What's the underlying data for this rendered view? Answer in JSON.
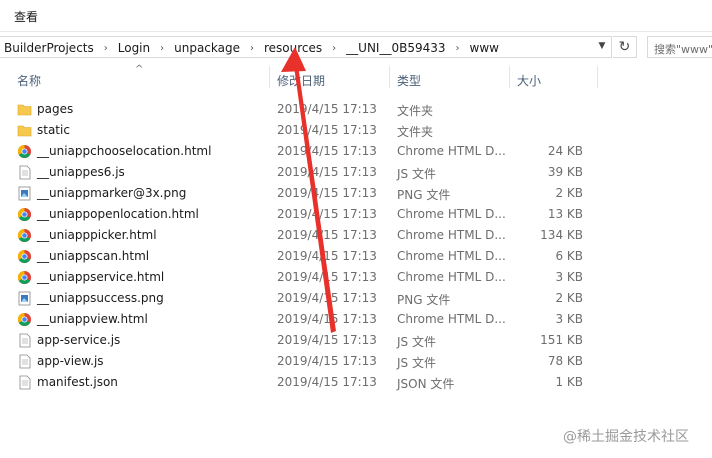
{
  "menubar": {
    "view_label": "查看"
  },
  "address": {
    "crumbs": [
      "BuilderProjects",
      "Login",
      "unpackage",
      "resources",
      "__UNI__0B59433",
      "www"
    ]
  },
  "search": {
    "placeholder": "搜索\"www\""
  },
  "columns": {
    "name": "名称",
    "date": "修改日期",
    "type": "类型",
    "size": "大小"
  },
  "files": [
    {
      "icon": "folder-icon",
      "name": "pages",
      "date": "2019/4/15 17:13",
      "type": "文件夹",
      "size": ""
    },
    {
      "icon": "folder-icon",
      "name": "static",
      "date": "2019/4/15 17:13",
      "type": "文件夹",
      "size": ""
    },
    {
      "icon": "chrome-html-icon",
      "name": "__uniappchooselocation.html",
      "date": "2019/4/15 17:13",
      "type": "Chrome HTML D...",
      "size": "24 KB"
    },
    {
      "icon": "js-file-icon",
      "name": "__uniappes6.js",
      "date": "2019/4/15 17:13",
      "type": "JS 文件",
      "size": "39 KB"
    },
    {
      "icon": "png-file-icon",
      "name": "__uniappmarker@3x.png",
      "date": "2019/4/15 17:13",
      "type": "PNG 文件",
      "size": "2 KB"
    },
    {
      "icon": "chrome-html-icon",
      "name": "__uniappopenlocation.html",
      "date": "2019/4/15 17:13",
      "type": "Chrome HTML D...",
      "size": "13 KB"
    },
    {
      "icon": "chrome-html-icon",
      "name": "__uniapppicker.html",
      "date": "2019/4/15 17:13",
      "type": "Chrome HTML D...",
      "size": "134 KB"
    },
    {
      "icon": "chrome-html-icon",
      "name": "__uniappscan.html",
      "date": "2019/4/15 17:13",
      "type": "Chrome HTML D...",
      "size": "6 KB"
    },
    {
      "icon": "chrome-html-icon",
      "name": "__uniappservice.html",
      "date": "2019/4/15 17:13",
      "type": "Chrome HTML D...",
      "size": "3 KB"
    },
    {
      "icon": "png-file-icon",
      "name": "__uniappsuccess.png",
      "date": "2019/4/15 17:13",
      "type": "PNG 文件",
      "size": "2 KB"
    },
    {
      "icon": "chrome-html-icon",
      "name": "__uniappview.html",
      "date": "2019/4/15 17:13",
      "type": "Chrome HTML D...",
      "size": "3 KB"
    },
    {
      "icon": "js-file-icon",
      "name": "app-service.js",
      "date": "2019/4/15 17:13",
      "type": "JS 文件",
      "size": "151 KB"
    },
    {
      "icon": "js-file-icon",
      "name": "app-view.js",
      "date": "2019/4/15 17:13",
      "type": "JS 文件",
      "size": "78 KB"
    },
    {
      "icon": "json-file-icon",
      "name": "manifest.json",
      "date": "2019/4/15 17:13",
      "type": "JSON 文件",
      "size": "1 KB"
    }
  ],
  "watermark": "@稀土掘金技术社区",
  "colors": {
    "annotation_arrow": "#e8312a",
    "folder": "#f6c94e",
    "header_text": "#4c607a"
  }
}
